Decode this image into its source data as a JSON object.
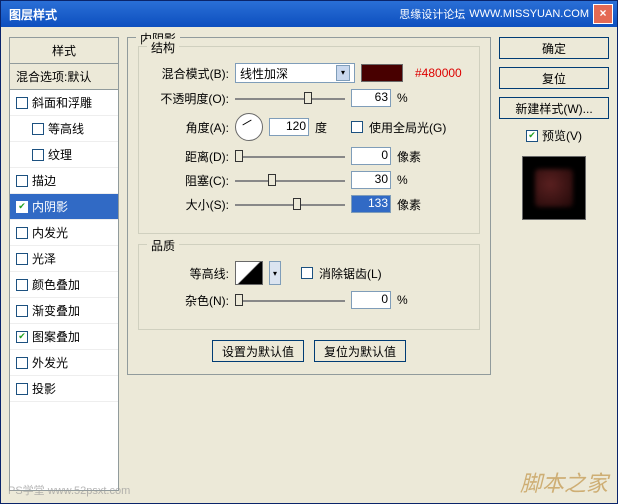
{
  "titlebar": {
    "title": "图层样式",
    "forum": "思缘设计论坛",
    "forum_url": "WWW.MISSYUAN.COM"
  },
  "sidebar": {
    "header": "样式",
    "sub": "混合选项:默认",
    "items": [
      {
        "label": "斜面和浮雕",
        "checked": false,
        "selected": false,
        "indent": false
      },
      {
        "label": "等高线",
        "checked": false,
        "selected": false,
        "indent": true
      },
      {
        "label": "纹理",
        "checked": false,
        "selected": false,
        "indent": true
      },
      {
        "label": "描边",
        "checked": false,
        "selected": false,
        "indent": false
      },
      {
        "label": "内阴影",
        "checked": true,
        "selected": true,
        "indent": false
      },
      {
        "label": "内发光",
        "checked": false,
        "selected": false,
        "indent": false
      },
      {
        "label": "光泽",
        "checked": false,
        "selected": false,
        "indent": false
      },
      {
        "label": "颜色叠加",
        "checked": false,
        "selected": false,
        "indent": false
      },
      {
        "label": "渐变叠加",
        "checked": false,
        "selected": false,
        "indent": false
      },
      {
        "label": "图案叠加",
        "checked": true,
        "selected": false,
        "indent": false
      },
      {
        "label": "外发光",
        "checked": false,
        "selected": false,
        "indent": false
      },
      {
        "label": "投影",
        "checked": false,
        "selected": false,
        "indent": false
      }
    ]
  },
  "panel": {
    "title": "内阴影",
    "structure_title": "结构",
    "blend_mode_label": "混合模式(B):",
    "blend_mode_value": "线性加深",
    "color_hex": "#480000",
    "opacity_label": "不透明度(O):",
    "opacity_value": "63",
    "opacity_unit": "%",
    "angle_label": "角度(A):",
    "angle_value": "120",
    "angle_unit": "度",
    "global_light_label": "使用全局光(G)",
    "distance_label": "距离(D):",
    "distance_value": "0",
    "distance_unit": "像素",
    "choke_label": "阻塞(C):",
    "choke_value": "30",
    "choke_unit": "%",
    "size_label": "大小(S):",
    "size_value": "133",
    "size_unit": "像素",
    "quality_title": "品质",
    "contour_label": "等高线:",
    "antialias_label": "消除锯齿(L)",
    "noise_label": "杂色(N):",
    "noise_value": "0",
    "noise_unit": "%",
    "make_default": "设置为默认值",
    "reset_default": "复位为默认值"
  },
  "actions": {
    "ok": "确定",
    "cancel": "复位",
    "new_style": "新建样式(W)...",
    "preview_label": "预览(V)"
  },
  "watermark": {
    "main": "脚本之家",
    "sub": "PS学堂  www.52psxt.com"
  }
}
